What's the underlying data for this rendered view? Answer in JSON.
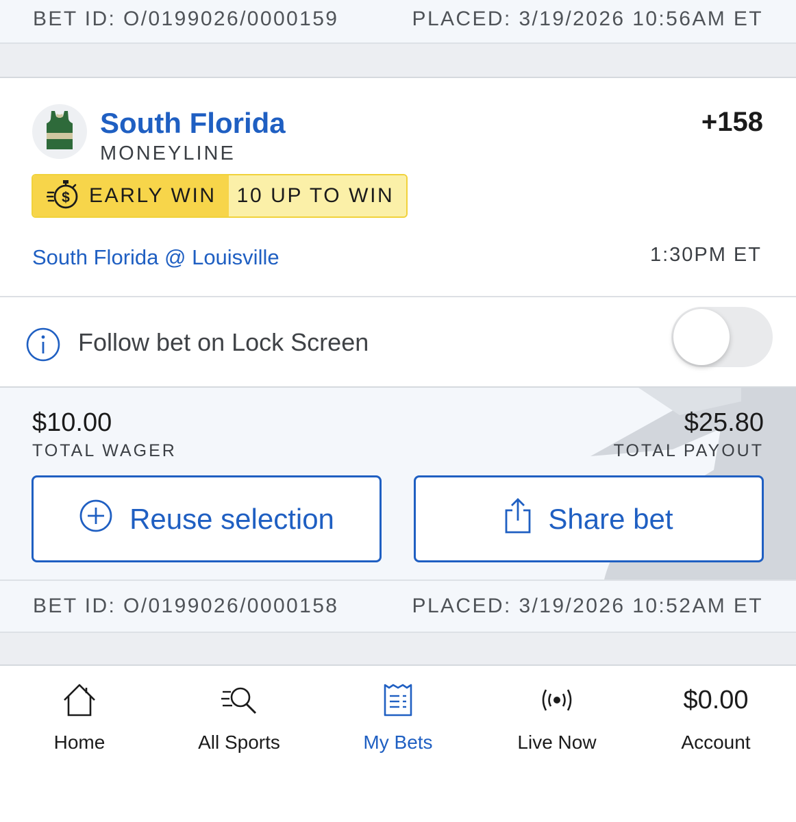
{
  "bet_top": {
    "bet_id": "BET ID: O/0199026/0000159",
    "placed": "PLACED: 3/19/2026 10:56AM ET"
  },
  "selection": {
    "team": "South Florida",
    "market": "MONEYLINE",
    "odds": "+158",
    "early_win_label": "EARLY WIN",
    "early_win_detail": "10 UP TO WIN",
    "matchup": "South Florida @ Louisville",
    "game_time": "1:30PM ET",
    "icons": {
      "team_logo": "jersey-icon",
      "early_win": "stopwatch-dollar-icon"
    }
  },
  "follow": {
    "label": "Follow bet on Lock Screen",
    "toggle_on": false,
    "icon": "info-icon"
  },
  "totals": {
    "wager_amount": "$10.00",
    "wager_label": "TOTAL WAGER",
    "payout_amount": "$25.80",
    "payout_label": "TOTAL PAYOUT"
  },
  "actions": {
    "reuse_label": "Reuse selection",
    "share_label": "Share bet",
    "icons": {
      "reuse": "plus-circle-icon",
      "share": "share-icon"
    }
  },
  "bet_bottom": {
    "bet_id": "BET ID: O/0199026/0000158",
    "placed": "PLACED: 3/19/2026 10:52AM ET"
  },
  "tabbar": {
    "home": "Home",
    "sports": "All Sports",
    "mybets": "My Bets",
    "live": "Live Now",
    "account_balance": "$0.00",
    "account": "Account",
    "active": "mybets"
  },
  "colors": {
    "accent": "#1f5fc2",
    "badge_yellow": "#f7d54a",
    "badge_light_yellow": "#fbf0a8",
    "jersey_green": "#2e6a3a",
    "jersey_stripe": "#cfc7a0"
  }
}
